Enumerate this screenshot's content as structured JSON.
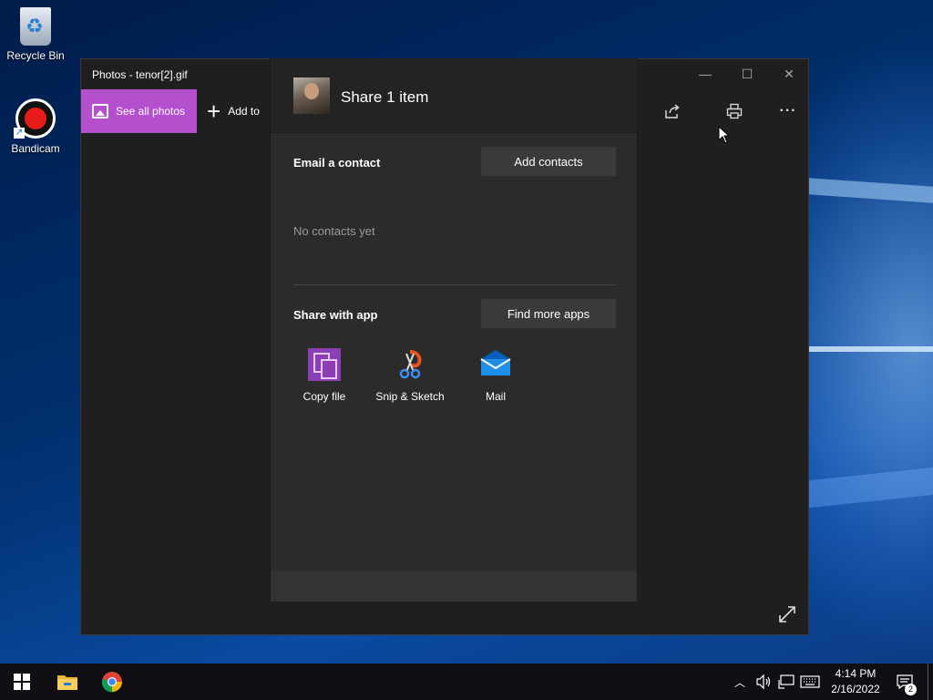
{
  "desktop": {
    "icons": [
      {
        "label": "Recycle Bin",
        "icon": "recycle-bin-icon"
      },
      {
        "label": "Bandicam",
        "icon": "bandicam-icon"
      }
    ]
  },
  "window": {
    "title": "Photos - tenor[2].gif",
    "controls": {
      "minimize": "—",
      "maximize": "☐",
      "close": "✕"
    },
    "toolbar": {
      "see_all_label": "See all photos",
      "add_to_label": "Add to",
      "share_icon": "share-icon",
      "print_icon": "print-icon",
      "more_icon": "ellipsis-icon",
      "more_glyph": "···"
    }
  },
  "share": {
    "title": "Share 1 item",
    "email_label": "Email a contact",
    "add_contacts_label": "Add contacts",
    "no_contacts_text": "No contacts yet",
    "share_app_label": "Share with app",
    "find_more_label": "Find more apps",
    "apps": [
      {
        "label": "Copy file",
        "icon": "copy-file-icon"
      },
      {
        "label": "Snip & Sketch",
        "icon": "snip-sketch-icon"
      },
      {
        "label": "Mail",
        "icon": "mail-icon"
      }
    ]
  },
  "taskbar": {
    "time": "4:14 PM",
    "date": "2/16/2022",
    "notification_count": "2",
    "pinned": [
      "start-icon",
      "file-explorer-icon",
      "chrome-icon"
    ]
  },
  "colors": {
    "accent": "#b44fce",
    "window_bg": "#1f1f1f",
    "panel_bg": "#2b2b2b",
    "taskbar_bg": "#0f0f14"
  }
}
